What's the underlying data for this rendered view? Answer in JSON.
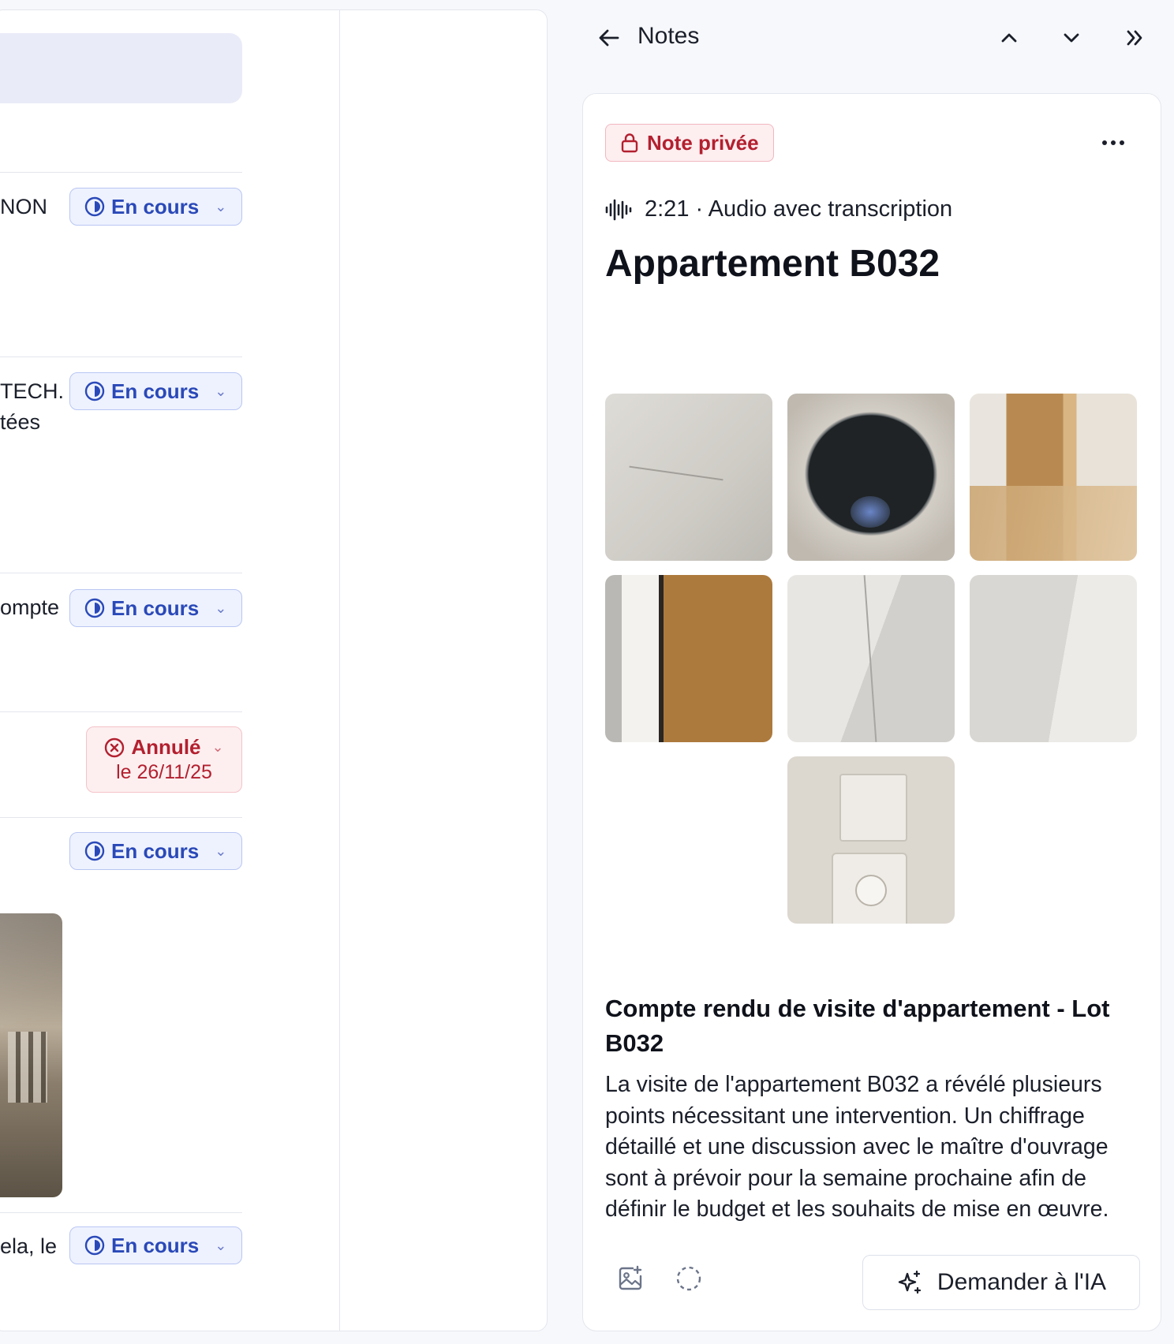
{
  "left_list": {
    "rows": [
      {
        "text": "NON",
        "status": "En cours"
      },
      {
        "text": "TECH.",
        "text2": "tées",
        "status": "En cours"
      },
      {
        "text": "ompte",
        "status": "En cours"
      },
      {
        "status": "Annulé",
        "status_date": "le 26/11/25"
      },
      {
        "status": "En cours"
      },
      {
        "text": "ela, le",
        "status": "En cours"
      }
    ]
  },
  "header": {
    "title": "Notes"
  },
  "note": {
    "badge": "Note privée",
    "audio_duration": "2:21",
    "audio_separator": "·",
    "audio_label": "Audio avec transcription",
    "title": "Appartement B032",
    "photos": [
      {
        "icon": "photo-wall-scratch"
      },
      {
        "icon": "photo-ceiling-hole"
      },
      {
        "icon": "photo-door-frame-floor"
      },
      {
        "icon": "photo-door-edge"
      },
      {
        "icon": "photo-wall-corner-crack"
      },
      {
        "icon": "photo-wall-crack"
      },
      {
        "icon": "photo-wall-switches"
      }
    ],
    "summary_title": "Compte rendu de visite d'appartement - Lot B032",
    "summary_body": "La visite de l'appartement B032 a révélé plusieurs points nécessitant une intervention. Un chiffrage détaillé et une discussion avec le maître d'ouvrage sont à prévoir pour la semaine prochaine afin de définir le budget et les souhaits de mise en œuvre.",
    "ai_button": "Demander à l'IA"
  },
  "colors": {
    "accent_blue": "#2a49b8",
    "danger_red": "#b3202f",
    "panel_bg": "#ffffff",
    "page_bg": "#f7f8fb"
  }
}
